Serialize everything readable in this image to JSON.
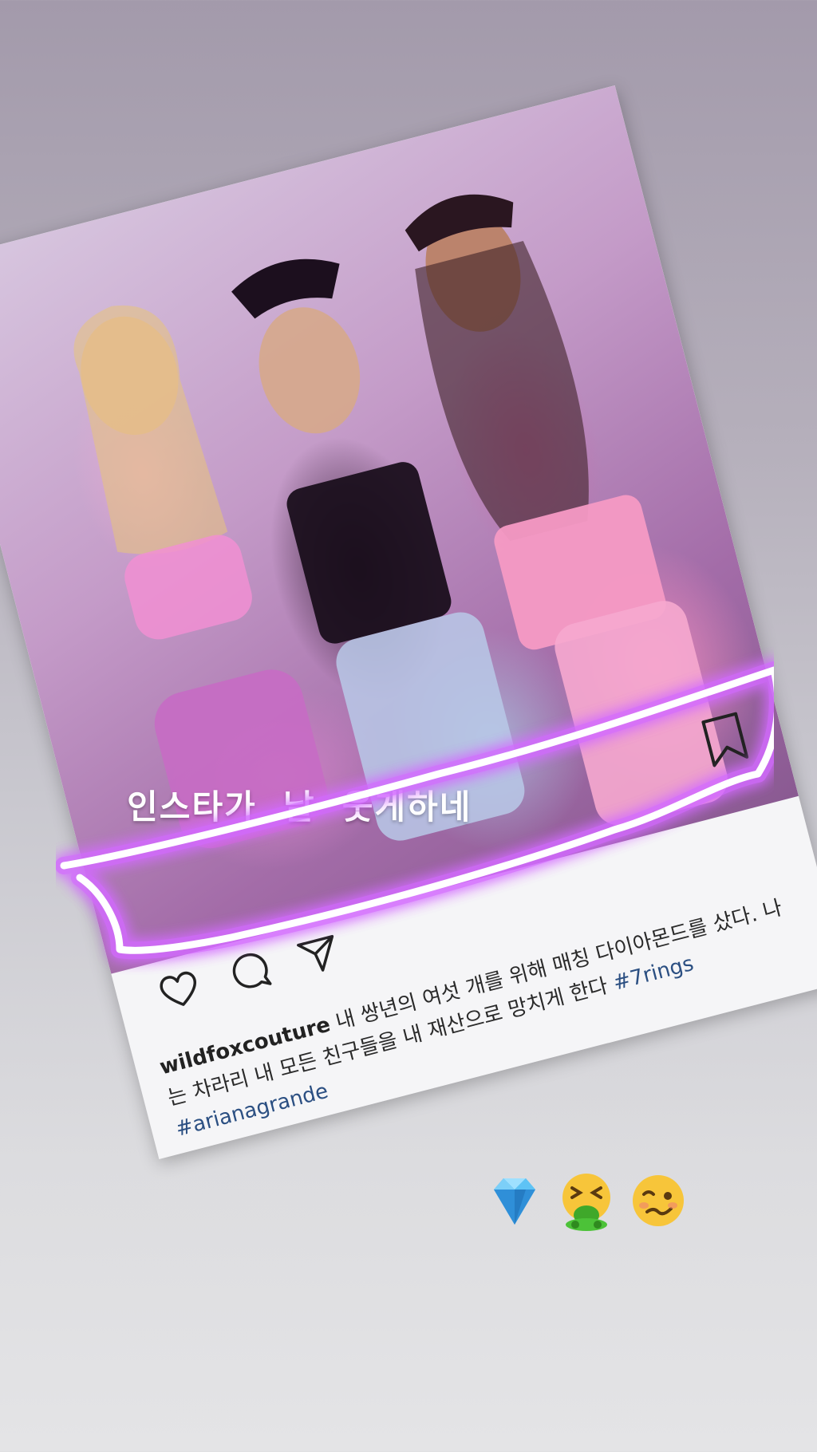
{
  "overlay_text": "인스타가  날  웃게하네",
  "post": {
    "username": "wildfoxcouture",
    "caption_text": " 내 쌍년의 여섯 개를 위해 매칭 다이아몬드를 샀다. 나는 차라리 내 모든 친구들을 내 재산으로 망치게 한다 ",
    "hashtags": [
      "#7rings",
      "#arianagrande"
    ]
  },
  "icons": {
    "like": "heart-icon",
    "comment": "comment-bubble-icon",
    "share": "paper-plane-icon",
    "save": "bookmark-icon"
  },
  "stickers": [
    "gem-emoji",
    "vomiting-face-emoji",
    "woozy-face-emoji"
  ],
  "colors": {
    "neon_glow": "#d36bff",
    "neon_core": "#ffffff",
    "hashtag": "#2b4f82"
  }
}
